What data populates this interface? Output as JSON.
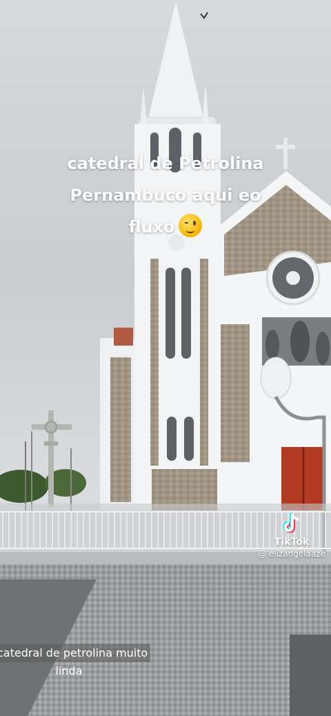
{
  "overlay_caption": {
    "line1": "catedral  de Petrolina",
    "line2": "Pernambuco aqui eo",
    "line3": "fluxo",
    "emoji": "winking-face"
  },
  "tiktok": {
    "brand": "TikTok",
    "handle": "@ elizangelaaze"
  },
  "bottom_subtitle": {
    "line1": "catedral de petrolina muito",
    "line2": "linda"
  },
  "colors": {
    "sky": "#cfd2d6",
    "church_white": "#f4f5f6",
    "stone": "#9c907f",
    "door": "#b23a24",
    "pavement": "#8d8f91"
  }
}
